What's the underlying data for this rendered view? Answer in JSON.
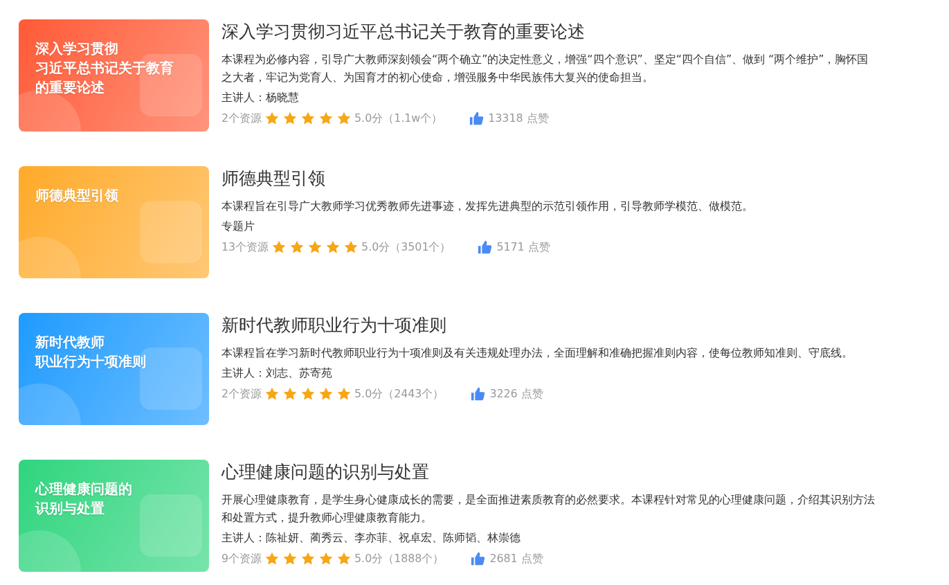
{
  "courses": [
    {
      "cover": {
        "lines": [
          "深入学习贯彻",
          "习近平总书记关于教育",
          "的重要论述"
        ],
        "color": "#ff5a36"
      },
      "title": "深入学习贯彻习近平总书记关于教育的重要论述",
      "description": "本课程为必修内容，引导广大教师深刻领会“两个确立”的决定性意义，增强“四个意识”、坚定“四个自信”、做到 “两个维护”，胸怀国之大者，牢记为党育人、为国育才的初心使命，增强服务中华民族伟大复兴的使命担当。",
      "meta": "主讲人：杨晓慧",
      "resources": "2个资源",
      "stars": 5,
      "score": "5.0分",
      "ratings": "（1.1w个）",
      "likes": "13318 点赞"
    },
    {
      "cover": {
        "lines": [
          "师德典型引领"
        ],
        "color": "#ffaa2a"
      },
      "title": "师德典型引领",
      "description": "本课程旨在引导广大教师学习优秀教师先进事迹，发挥先进典型的示范引领作用，引导教师学模范、做模范。",
      "meta": "专题片",
      "resources": "13个资源",
      "stars": 5,
      "score": "5.0分",
      "ratings": "（3501个）",
      "likes": "5171 点赞"
    },
    {
      "cover": {
        "lines": [
          "新时代教师",
          "职业行为十项准则"
        ],
        "color": "#1e9bff"
      },
      "title": "新时代教师职业行为十项准则",
      "description": "本课程旨在学习新时代教师职业行为十项准则及有关违规处理办法，全面理解和准确把握准则内容，使每位教师知准则、守底线。",
      "meta": "主讲人：刘志、苏寄苑",
      "resources": "2个资源",
      "stars": 5,
      "score": "5.0分",
      "ratings": "（2443个）",
      "likes": "3226 点赞"
    },
    {
      "cover": {
        "lines": [
          "心理健康问题的",
          "识别与处置"
        ],
        "color": "#2fd57e"
      },
      "title": "心理健康问题的识别与处置",
      "description": "开展心理健康教育，是学生身心健康成长的需要，是全面推进素质教育的必然要求。本课程针对常见的心理健康问题，介绍其识别方法和处置方式，提升教师心理健康教育能力。",
      "meta": "主讲人：陈祉妍、蔺秀云、李亦菲、祝卓宏、陈师韬、林崇德",
      "resources": "9个资源",
      "stars": 5,
      "score": "5.0分",
      "ratings": "（1888个）",
      "likes": "2681 点赞"
    }
  ]
}
